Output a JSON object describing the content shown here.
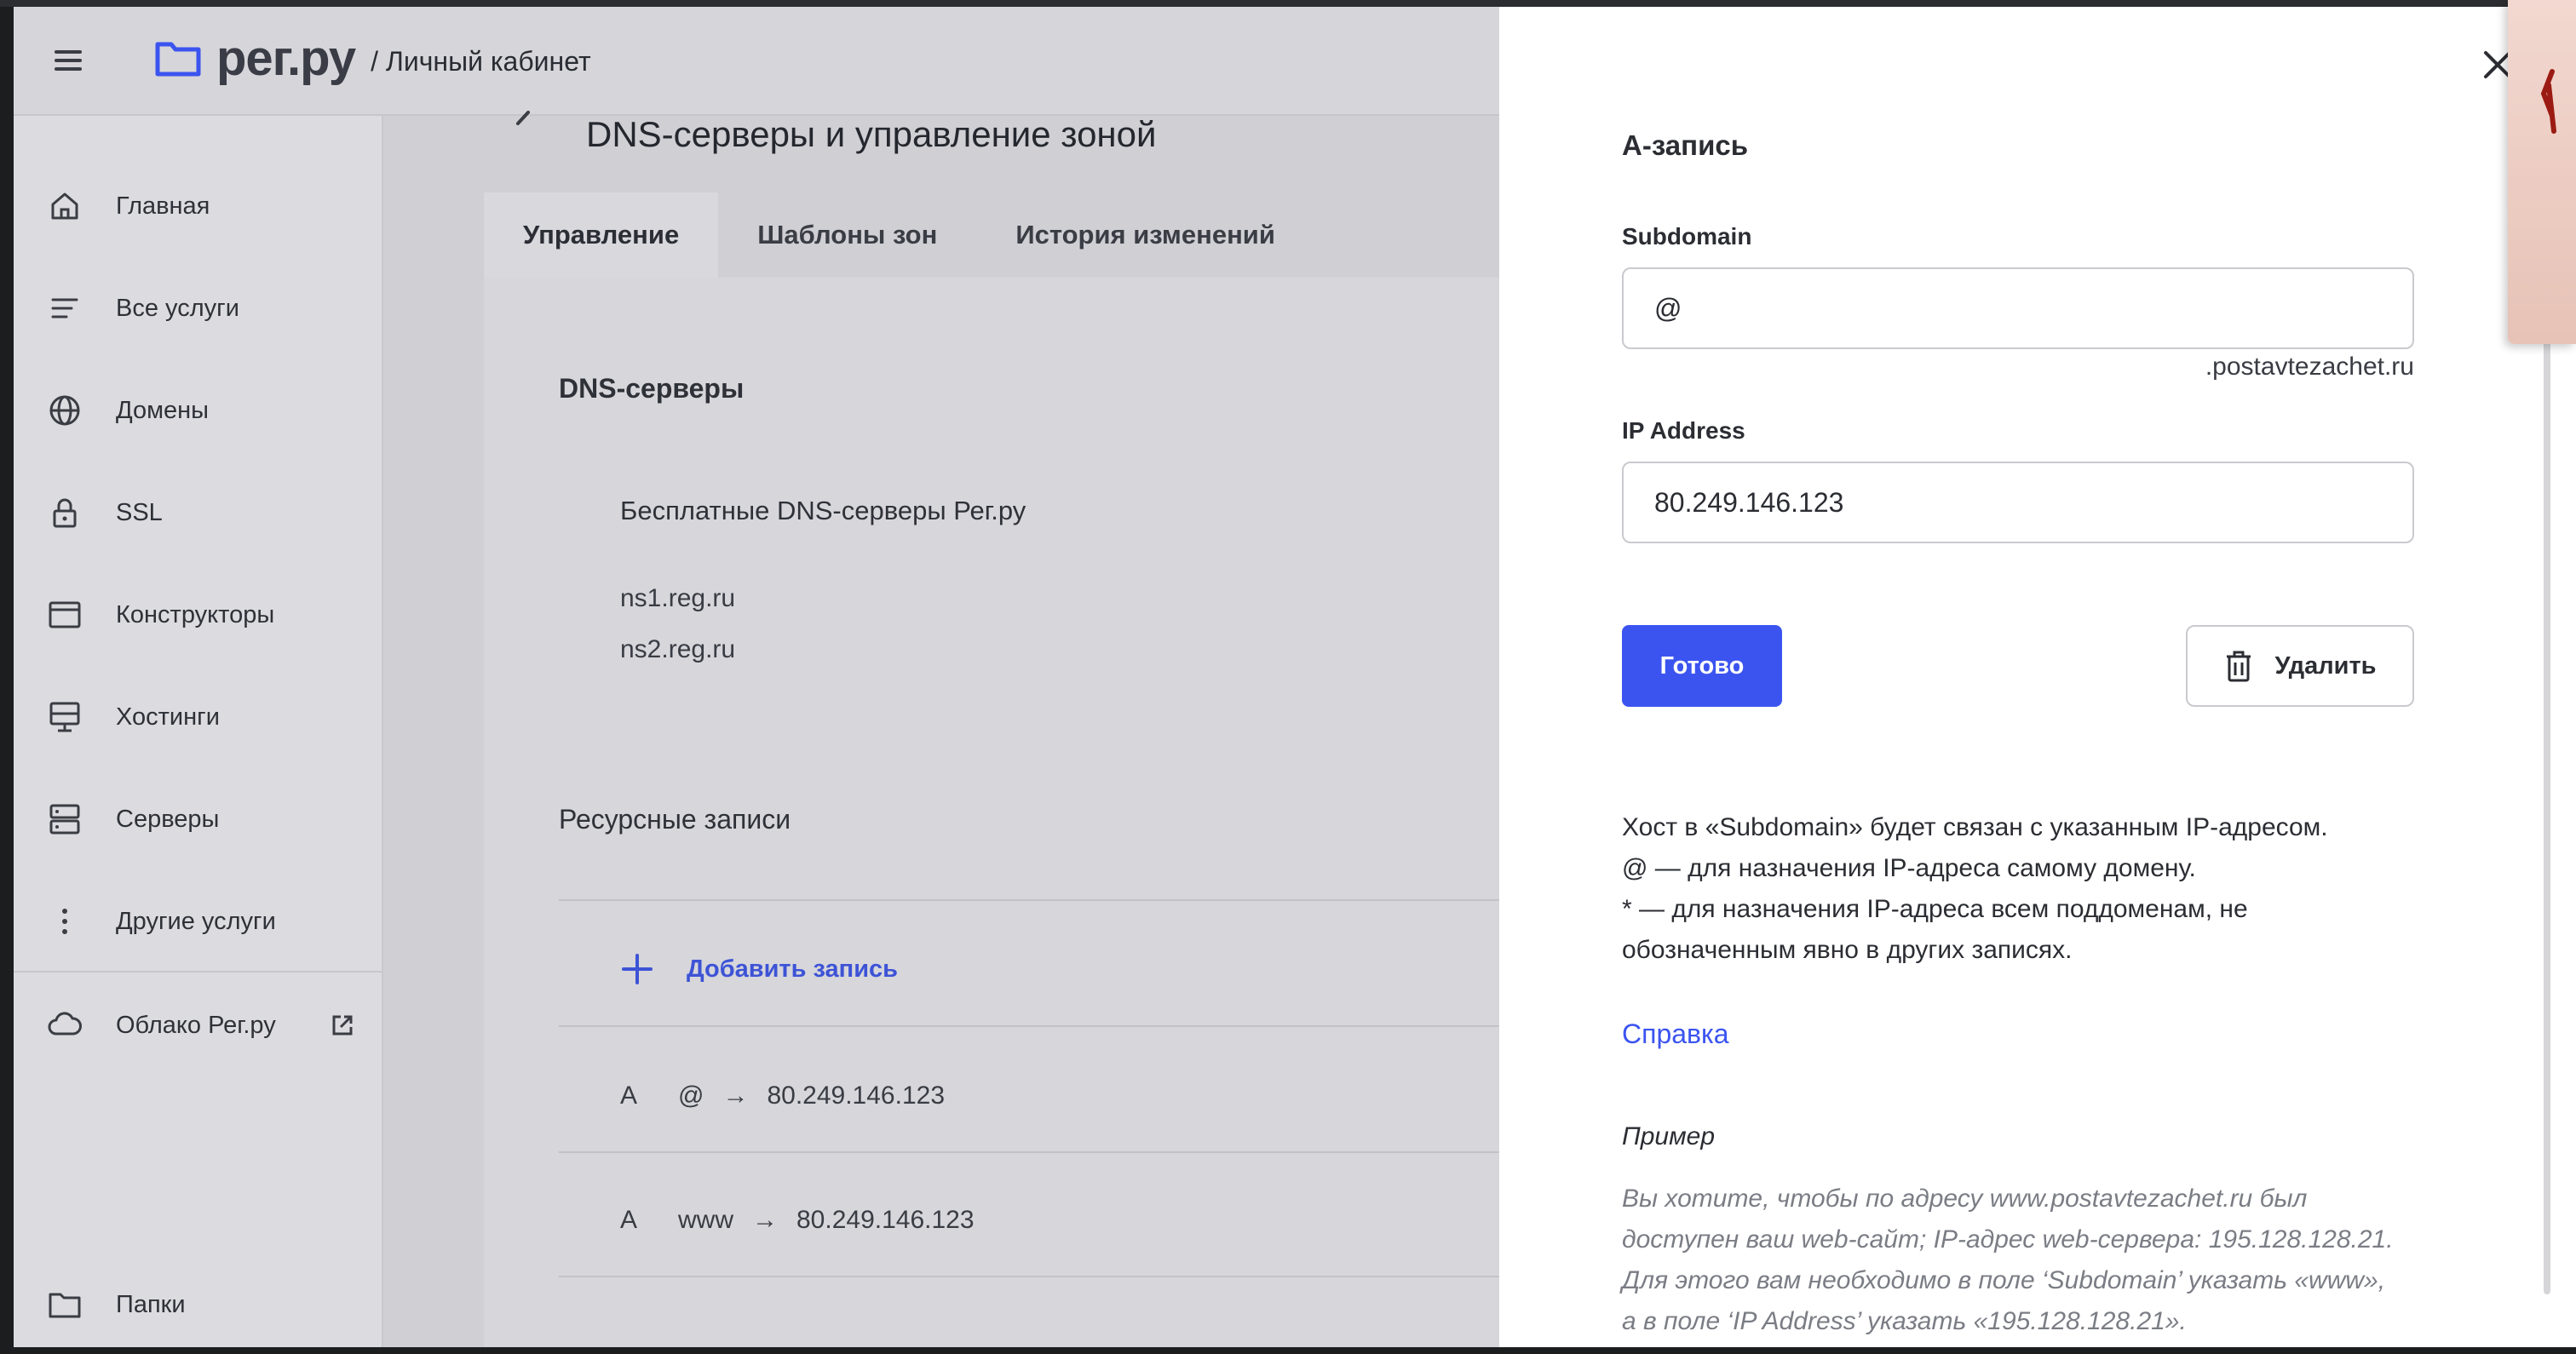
{
  "header": {
    "menu_icon": "hamburger-icon",
    "logo_text": "рег.ру",
    "logo_icon": "folder-logo-icon",
    "section": "/ Личный кабинет"
  },
  "sidebar": {
    "items": [
      {
        "label": "Главная",
        "icon": "home-icon"
      },
      {
        "label": "Все услуги",
        "icon": "list-icon"
      },
      {
        "label": "Домены",
        "icon": "globe-icon"
      },
      {
        "label": "SSL",
        "icon": "lock-icon"
      },
      {
        "label": "Конструкторы",
        "icon": "browser-window-icon"
      },
      {
        "label": "Хостинги",
        "icon": "monitor-icon"
      },
      {
        "label": "Серверы",
        "icon": "server-icon"
      },
      {
        "label": "Другие услуги",
        "icon": "more-vertical-icon"
      },
      {
        "label": "Облако Рег.ру",
        "icon": "cloud-icon",
        "external_icon": "external-link-icon"
      },
      {
        "label": "Папки",
        "icon": "folder-icon"
      }
    ]
  },
  "main": {
    "page_title": "DNS-серверы и управление зоной",
    "tabs": [
      {
        "label": "Управление",
        "active": true
      },
      {
        "label": "Шаблоны зон",
        "active": false
      },
      {
        "label": "История изменений",
        "active": false
      }
    ],
    "dns_section_title": "DNS-серверы",
    "dns_free_title": "Бесплатные DNS-серверы Рег.ру",
    "dns_servers": [
      "ns1.reg.ru",
      "ns2.reg.ru"
    ],
    "records_section_title": "Ресурсные записи",
    "add_record_label": "Добавить запись",
    "records": [
      {
        "type": "A",
        "host": "@",
        "arrow": "→",
        "value": "80.249.146.123"
      },
      {
        "type": "A",
        "host": "www",
        "arrow": "→",
        "value": "80.249.146.123"
      }
    ]
  },
  "drawer": {
    "title": "A-запись",
    "subdomain_label": "Subdomain",
    "subdomain_value": "@",
    "domain_suffix": ".postavtezachet.ru",
    "ip_label": "IP Address",
    "ip_value": "80.249.146.123",
    "done_label": "Готово",
    "delete_label": "Удалить",
    "help_lines": [
      "Хост в «Subdomain» будет связан с указанным IP-адресом.",
      "@ — для назначения IP-адреса самому домену.",
      "* — для назначения IP-адреса всем поддоменам, не",
      "обозначенным явно в других записях."
    ],
    "help_link": "Справка",
    "example_title": "Пример",
    "example_lines": [
      "Вы хотите, чтобы по адресу www.postavtezachet.ru был",
      "доступен ваш web-сайт; IP-адрес web-сервера: 195.128.128.21.",
      "Для этого вам необходимо в поле ‘Subdomain’ указать «www»,",
      "а в поле ‘IP Address’ указать «195.128.128.21»."
    ]
  },
  "colors": {
    "accent": "#3b54f0",
    "link": "#3d53d6",
    "overlay_bg": "#d6d6db"
  }
}
